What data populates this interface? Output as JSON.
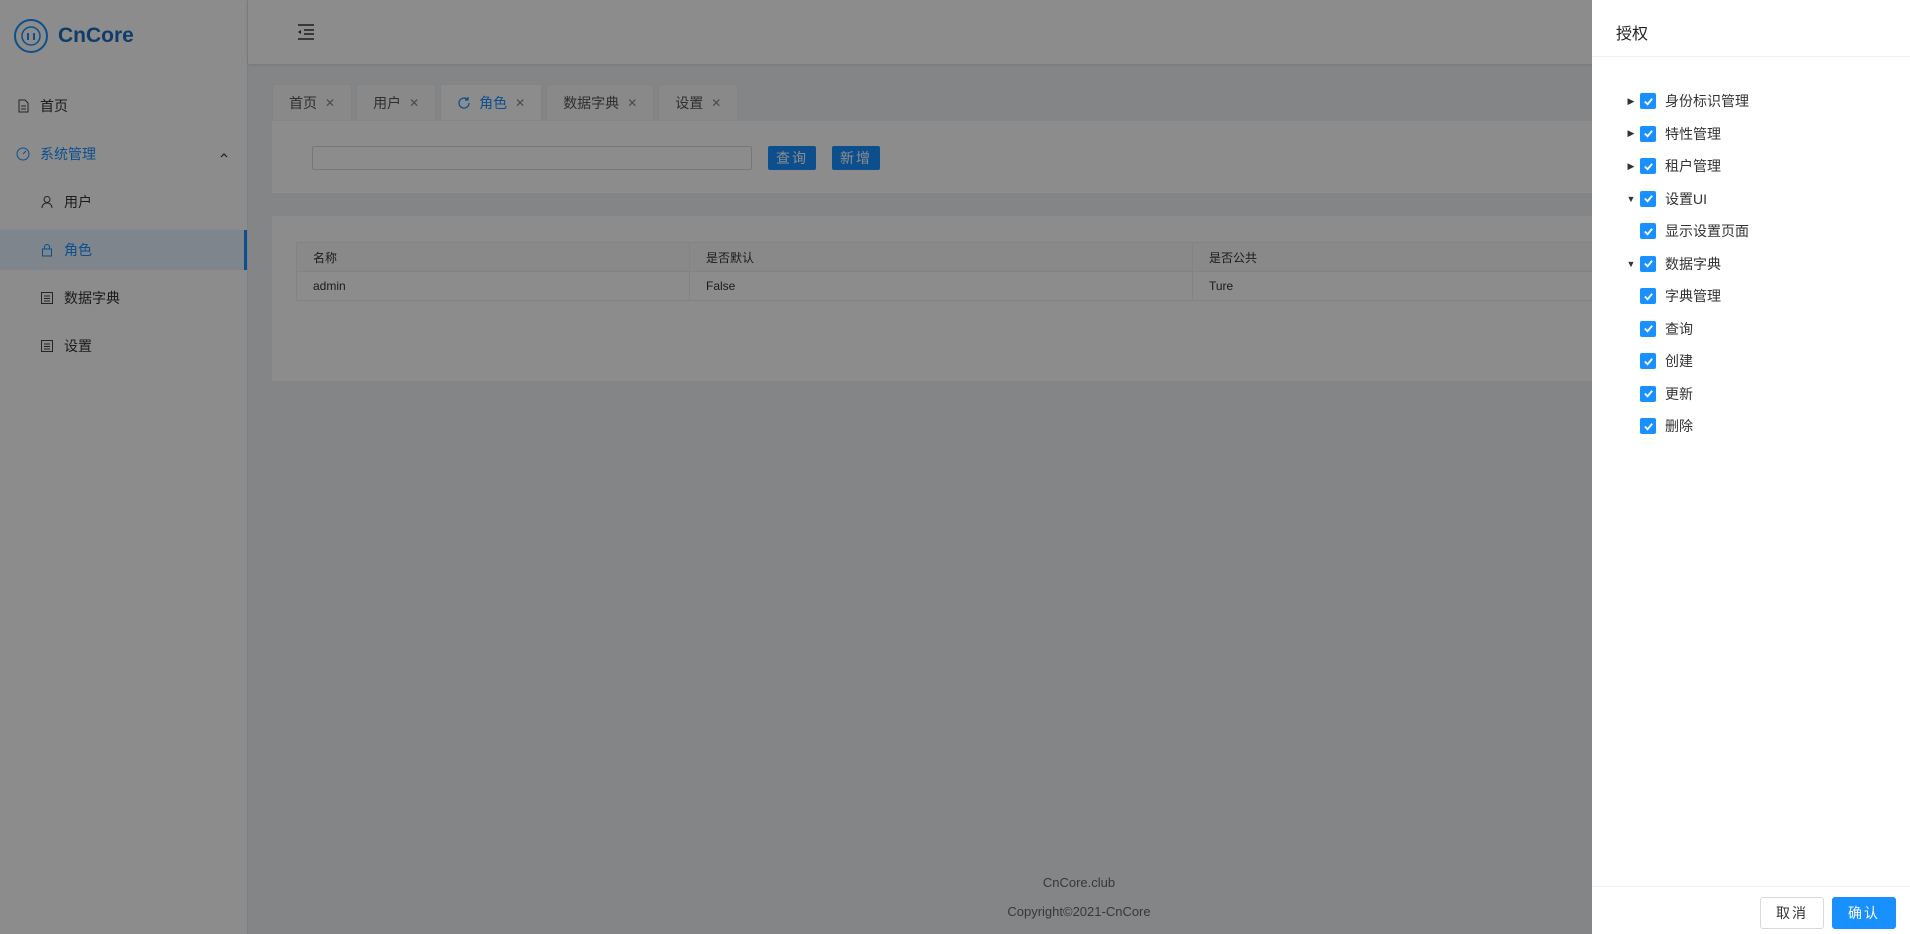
{
  "app": {
    "name": "CnCore"
  },
  "sidebar": {
    "items": [
      {
        "label": "首页"
      },
      {
        "label": "系统管理"
      },
      {
        "label": "用户"
      },
      {
        "label": "角色"
      },
      {
        "label": "数据字典"
      },
      {
        "label": "设置"
      }
    ]
  },
  "tabs": [
    {
      "label": "首页"
    },
    {
      "label": "用户"
    },
    {
      "label": "角色"
    },
    {
      "label": "数据字典"
    },
    {
      "label": "设置"
    }
  ],
  "search": {
    "placeholder": "",
    "query_label": "查询",
    "add_label": "新增"
  },
  "table": {
    "headers": [
      "名称",
      "是否默认",
      "是否公共"
    ],
    "rows": [
      [
        "admin",
        "False",
        "Ture"
      ]
    ]
  },
  "footer": {
    "line1": "CnCore.club",
    "line2": "Copyright©2021-CnCore"
  },
  "drawer": {
    "title": "授权",
    "tree": [
      {
        "label": "身份标识管理",
        "expanded": false,
        "checked": true
      },
      {
        "label": "特性管理",
        "expanded": false,
        "checked": true
      },
      {
        "label": "租户管理",
        "expanded": false,
        "checked": true
      },
      {
        "label": "设置UI",
        "expanded": true,
        "checked": true
      },
      {
        "label": "显示设置页面",
        "checked": true
      },
      {
        "label": "数据字典",
        "expanded": true,
        "checked": true
      },
      {
        "label": "字典管理",
        "checked": true
      },
      {
        "label": "查询",
        "checked": true
      },
      {
        "label": "创建",
        "checked": true
      },
      {
        "label": "更新",
        "checked": true
      },
      {
        "label": "删除",
        "checked": true
      }
    ],
    "cancel_label": "取消",
    "ok_label": "确认"
  },
  "colors": {
    "accent": "#1890ff",
    "mask": "rgba(0,0,0,0.45)"
  }
}
